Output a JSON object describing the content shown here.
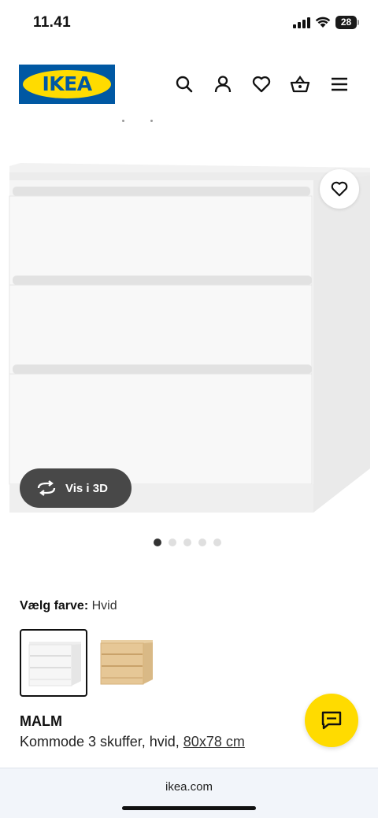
{
  "status_bar": {
    "time": "11.41",
    "battery": "28"
  },
  "header": {
    "logo_text": "IKEA",
    "icons": [
      "search-icon",
      "user-icon",
      "heart-icon",
      "basket-icon",
      "menu-icon"
    ]
  },
  "product_image": {
    "view_3d_label": "Vis i 3D",
    "gallery_count": 5,
    "gallery_active_index": 0
  },
  "color_picker": {
    "label": "Vælg farve:",
    "selected": "Hvid",
    "options": [
      "white-swatch",
      "oak-swatch"
    ]
  },
  "product": {
    "name": "MALM",
    "description": "Kommode 3 skuffer, hvid,",
    "size": "80x78 cm"
  },
  "browser": {
    "url": "ikea.com"
  },
  "colors": {
    "ikea_blue": "#0058a3",
    "ikea_yellow": "#ffdb00"
  }
}
